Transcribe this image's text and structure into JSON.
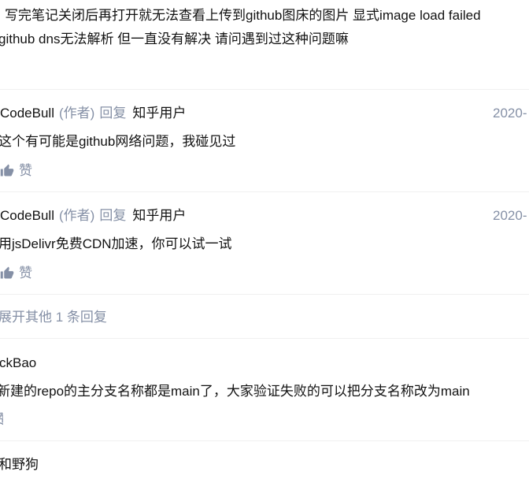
{
  "first_comment": {
    "line1": "写完笔记关闭后再打开就无法查看上传到github图床的图片 显式image load failed",
    "line2": "github dns无法解析 但一直没有解决 请问遇到过这种问题嘛"
  },
  "replies": [
    {
      "author": "CodeBull",
      "author_tag": "(作者)",
      "reply_word": "回复",
      "reply_to": "知乎用户",
      "date": "2020-",
      "content": "这个有可能是github网络问题，我碰见过",
      "like_label": "赞",
      "like_icon": "thumbs-up-icon"
    },
    {
      "author": "CodeBull",
      "author_tag": "(作者)",
      "reply_word": "回复",
      "reply_to": "知乎用户",
      "date": "2020-",
      "content": "用jsDelivr免费CDN加速，你可以试一试",
      "like_label": "赞",
      "like_icon": "thumbs-up-icon"
    }
  ],
  "expand_more": "展开其他 1 条回复",
  "comment_2": {
    "author": "ckBao",
    "content": "新建的repo的主分支名称都是main了，大家验证失败的可以把分支名称改为main",
    "like_label": "赞"
  },
  "comment_3": {
    "author": "和野狗"
  },
  "colors": {
    "text": "#121212",
    "meta": "#8590a6",
    "divider": "#f0f0f0"
  }
}
